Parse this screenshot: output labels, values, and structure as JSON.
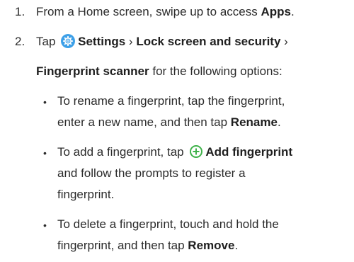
{
  "steps": [
    {
      "number": "1.",
      "pre": "From a Home screen, swipe up to access ",
      "bold": "Apps",
      "post": "."
    },
    {
      "number": "2.",
      "line1_pre": "Tap ",
      "settings_label": "Settings",
      "sep1": " › ",
      "lock_label": "Lock screen and security",
      "sep2": " ›",
      "line2_bold": "Fingerprint scanner",
      "line2_post": " for the following options:"
    }
  ],
  "bullets": [
    {
      "line1": "To rename a fingerprint, tap the fingerprint,",
      "line2_pre": "enter a new name, and then tap ",
      "line2_bold": "Rename",
      "line2_post": "."
    },
    {
      "line1_pre": "To add a fingerprint, tap ",
      "line1_bold": "Add fingerprint",
      "line2": "and follow the prompts to register a",
      "line3": "fingerprint."
    },
    {
      "line1": "To delete a fingerprint, touch and hold the",
      "line2_pre": "fingerprint, and then tap ",
      "line2_bold": "Remove",
      "line2_post": "."
    }
  ],
  "bullet_char": "•",
  "icons": {
    "settings": "gear-icon",
    "add": "plus-circle-icon"
  },
  "colors": {
    "settings_icon": "#3da0e8",
    "add_icon": "#3fb24a"
  }
}
